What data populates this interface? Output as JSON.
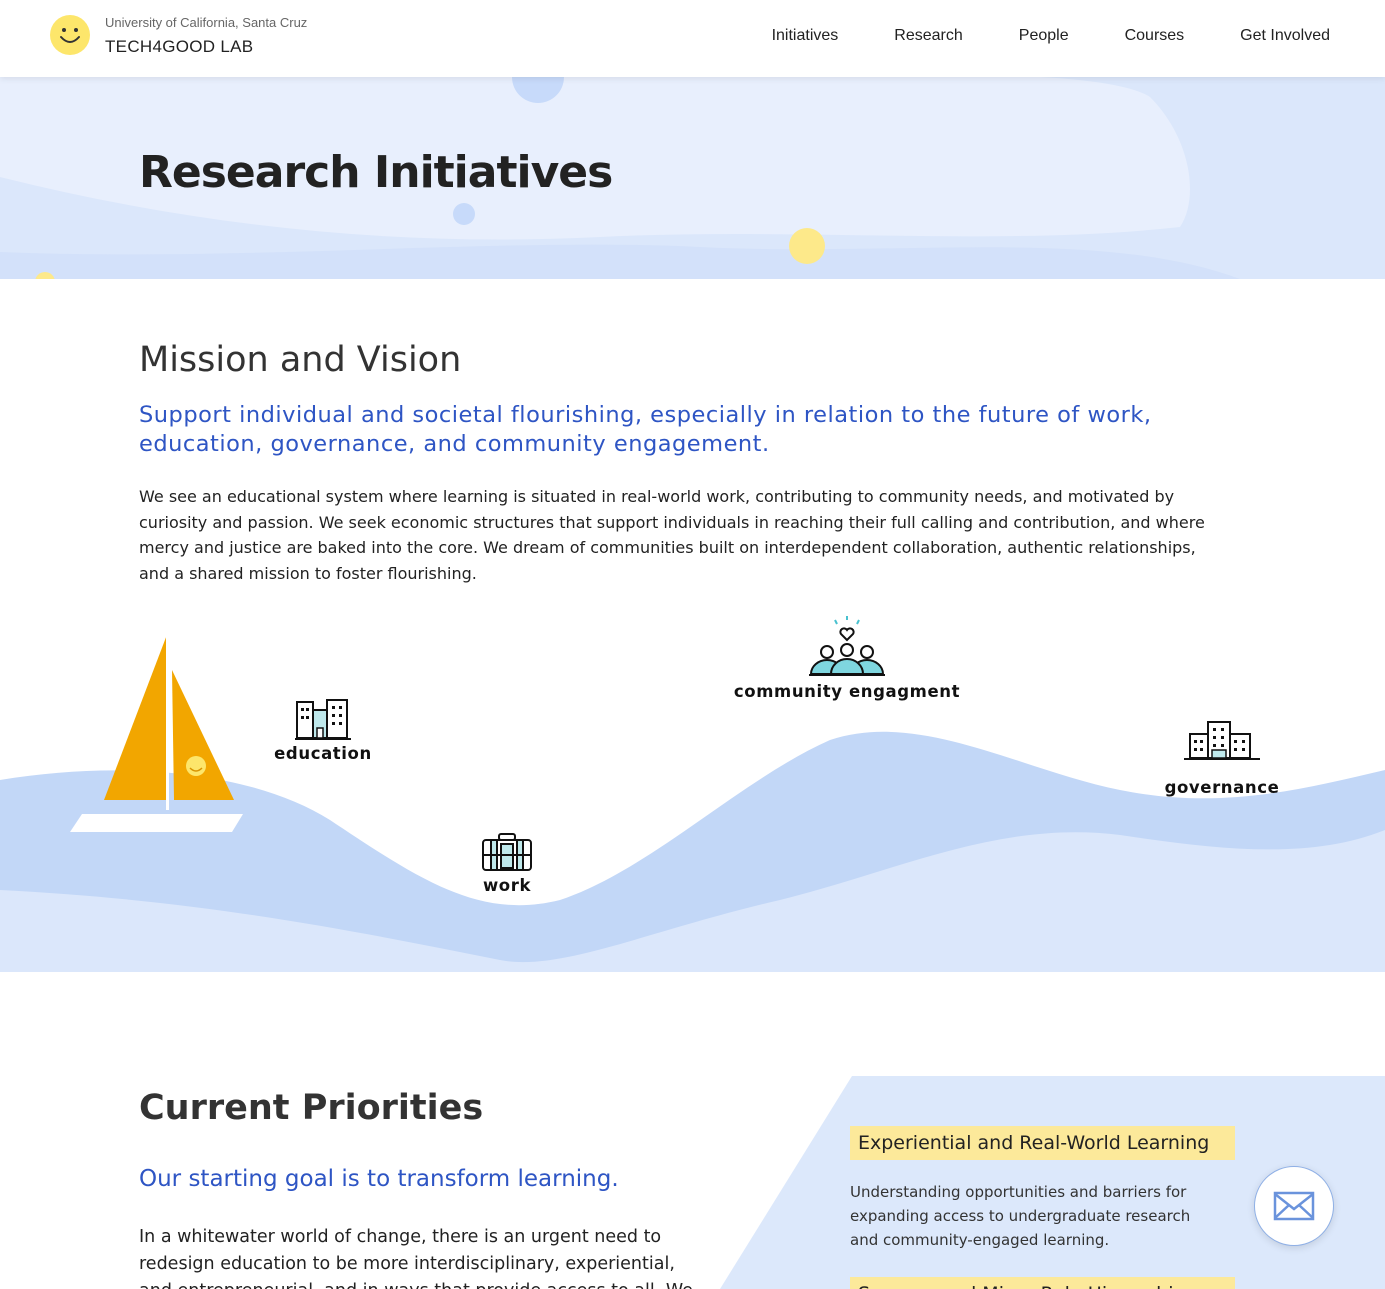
{
  "header": {
    "university": "University of California, Santa Cruz",
    "lab_name": "TECH4GOOD LAB",
    "nav": [
      "Initiatives",
      "Research",
      "People",
      "Courses",
      "Get Involved"
    ]
  },
  "hero": {
    "title": "Research Initiatives"
  },
  "mission": {
    "heading": "Mission and Vision",
    "subheading": "Support individual and societal flourishing, especially in relation to the future of work, education, governance, and community engagement.",
    "body": "We see an educational system where learning is situated in real-world work, contributing to community needs, and motivated by curiosity and passion. We seek economic structures that support individuals in reaching their full calling and contribution, and where mercy and justice are baked into the core. We dream of communities built on interdependent collaboration, authentic relationships, and a shared mission to foster flourishing."
  },
  "focus_areas": {
    "education": "education",
    "work": "work",
    "community": "community engagment",
    "governance": "governance"
  },
  "priorities": {
    "heading": "Current Priorities",
    "subheading": "Our starting goal is to transform learning.",
    "body": "In a whitewater world of change, there is an urgent need to redesign education to be more interdisciplinary, experiential, and entrepreneurial, and in ways that provide access to all. We are doing",
    "cards": [
      {
        "title": "Experiential and Real-World Learning",
        "description": "Understanding opportunities and barriers for expanding access to undergraduate research and community-engaged learning."
      },
      {
        "title": "Success and Micro-Role Hierarchies",
        "description": ""
      }
    ]
  },
  "colors": {
    "accent_blue": "#2e55c4",
    "wave_light": "#dce8fb",
    "wave_mid": "#c2d7f7",
    "highlight_yellow": "#fce99a",
    "sail_orange": "#f2a600",
    "smiley_yellow": "#fde66b"
  },
  "icons": {
    "logo": "smiley-face-icon",
    "contact": "envelope-icon"
  }
}
